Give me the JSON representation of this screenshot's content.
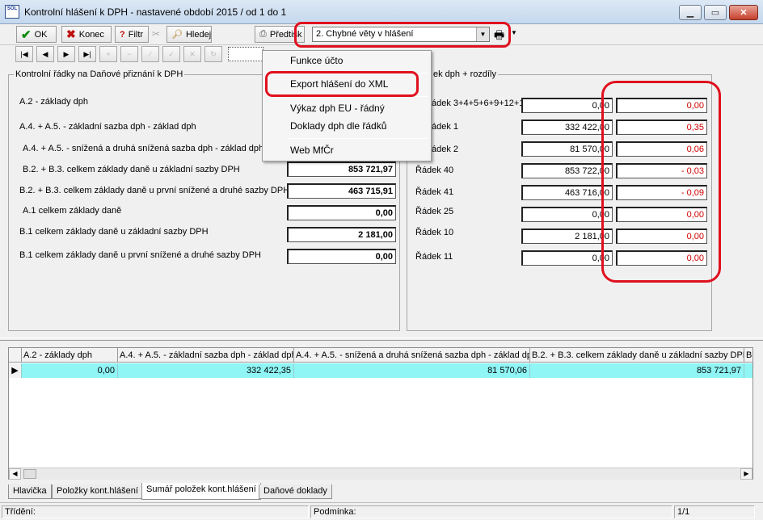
{
  "window": {
    "title": "Kontrolní hlášení k DPH - nastavené období 2015 / od 1 do 1",
    "app_icon_text": "SOL",
    "controls": [
      "minimize",
      "maximize",
      "close"
    ]
  },
  "toolbar": {
    "ok_label": "OK",
    "konec_label": "Konec",
    "filtr_label": "Filtr",
    "hledej_label": "Hledej",
    "predtisk_label": "Předtisk",
    "report_combo_value": "2. Chybné věty v hlášení"
  },
  "navigation": [
    "first",
    "prev",
    "next",
    "last",
    "add",
    "delete",
    "edit",
    "post",
    "cancel",
    "refresh"
  ],
  "left_panel": {
    "title": "Kontrolní řádky na Daňové přiznání k DPH",
    "rows": [
      {
        "label": "A.2 - základy dph",
        "value": ""
      },
      {
        "label": "A.4. + A.5. - základní sazba dph - základ dph",
        "value": ""
      },
      {
        "label": "A.4. + A.5. - snížená a druhá snížená sazba dph - základ dph",
        "value": ""
      },
      {
        "label": "B.2. + B.3. celkem základy daně u základní sazby DPH",
        "value": "853 721,97"
      },
      {
        "label": "B.2. + B.3. celkem základy daně u první snížené a druhé sazby DPH",
        "value": "463 715,91"
      },
      {
        "label": "A.1 celkem základy daně",
        "value": "0,00"
      },
      {
        "label": "B.1 celkem základy daně u základní sazby DPH",
        "value": "2 181,00"
      },
      {
        "label": "B.1 celkem základy daně u první snížené a druhé sazby DPH",
        "value": "0,00"
      }
    ]
  },
  "right_panel": {
    "title": "ek dph + rozdíly",
    "rows": [
      {
        "label": "ádek 3+4+5+6+9+12+13",
        "value": "0,00",
        "diff": "0,00"
      },
      {
        "label": "ádek 1",
        "value": "332 422,00",
        "diff": "0,35"
      },
      {
        "label": "ádek 2",
        "value": "81 570,00",
        "diff": "0,06"
      },
      {
        "label": "Řádek 40",
        "value": "853 722,00",
        "diff": "-  0,03"
      },
      {
        "label": "Řádek 41",
        "value": "463 716,00",
        "diff": "-  0,09"
      },
      {
        "label": "Řádek 25",
        "value": "0,00",
        "diff": "0,00"
      },
      {
        "label": "Řádek 10",
        "value": "2 181,00",
        "diff": "0,00"
      },
      {
        "label": "Řádek 11",
        "value": "0,00",
        "diff": "0,00"
      }
    ]
  },
  "context_menu": {
    "items": [
      "Funkce účto",
      "Export hlášení do XML",
      "Výkaz dph EU - řádný",
      "Doklady dph dle řádků",
      "Web MfČr"
    ],
    "highlighted_item": "Export hlášení do XML"
  },
  "grid": {
    "columns": [
      "A.2 - základy dph",
      "A.4. + A.5. - základní sazba dph - základ dph",
      "A.4. + A.5. - snížená a druhá snížená sazba dph - základ dph",
      "B.2. + B.3. celkem základy daně u základní sazby DPH",
      "B"
    ],
    "rows": [
      [
        "0,00",
        "332 422,35",
        "81 570,06",
        "853 721,97",
        ""
      ]
    ],
    "row_indicator": "▶"
  },
  "tabs": [
    "Hlavička",
    "Položky kont.hlášení",
    "Sumář položek kont.hlášení",
    "Daňové doklady"
  ],
  "active_tab": "Sumář položek kont.hlášení",
  "statusbar": {
    "sort_label": "Třídění:",
    "condition_label": "Podmínka:",
    "record_pos": "1/1"
  },
  "colors": {
    "highlight_red": "#e0101e",
    "diff_text": "#d00000",
    "selected_row": "#8ff5f5"
  }
}
